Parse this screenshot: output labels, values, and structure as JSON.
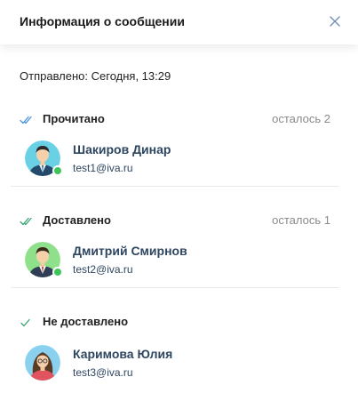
{
  "header": {
    "title": "Информация о сообщении"
  },
  "sent": {
    "label": "Отправлено:",
    "value": "Сегодня, 13:29"
  },
  "sections": [
    {
      "title": "Прочитано",
      "remaining": "осталось 2",
      "check": "double-check-icon",
      "user": {
        "name": "Шакиров Динар",
        "email": "test1@iva.ru",
        "online": true
      }
    },
    {
      "title": "Доставлено",
      "remaining": "осталось 1",
      "check": "double-check-icon",
      "user": {
        "name": "Дмитрий Смирнов",
        "email": "test2@iva.ru",
        "online": true
      }
    },
    {
      "title": "Не доставлено",
      "remaining": "",
      "check": "check-icon",
      "user": {
        "name": "Каримова Юлия",
        "email": "test3@iva.ru",
        "online": false
      }
    }
  ],
  "colors": {
    "accent": "#4a90e2",
    "online": "#3ec55a",
    "name_text": "#2e4660",
    "muted": "#8a8a8a"
  }
}
